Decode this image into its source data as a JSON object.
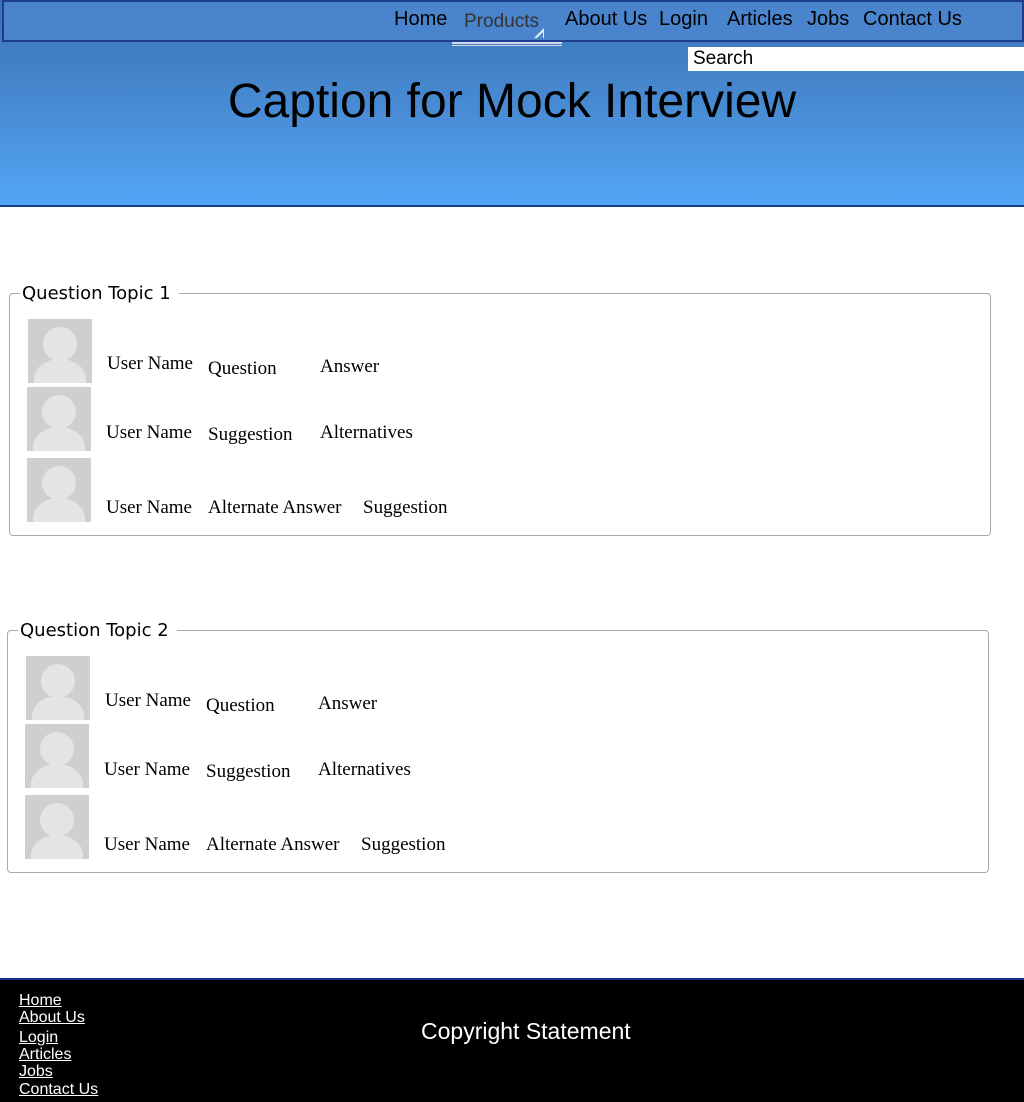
{
  "nav": {
    "home": "Home",
    "products": "Products",
    "about_us": "About Us",
    "login": "Login",
    "articles": "Articles",
    "jobs": "Jobs",
    "contact_us": "Contact Us"
  },
  "search": {
    "placeholder": "Search"
  },
  "header": {
    "title": "Caption for Mock Interview"
  },
  "topics": [
    {
      "title": "Question Topic 1",
      "rows": [
        {
          "user": "User Name",
          "col1": "Question",
          "col2": "Answer"
        },
        {
          "user": "User Name",
          "col1": "Suggestion",
          "col2": "Alternatives"
        },
        {
          "user": "User Name",
          "col1": "Alternate Answer",
          "col2": "Suggestion"
        }
      ]
    },
    {
      "title": "Question Topic 2",
      "rows": [
        {
          "user": "User Name",
          "col1": "Question",
          "col2": "Answer"
        },
        {
          "user": "User Name",
          "col1": "Suggestion",
          "col2": "Alternatives"
        },
        {
          "user": "User Name",
          "col1": "Alternate Answer",
          "col2": "Suggestion"
        }
      ]
    }
  ],
  "footer": {
    "links": [
      "Home",
      "About Us",
      "Login",
      "Articles",
      "Jobs",
      "Contact Us"
    ],
    "copyright": "Copyright Statement"
  },
  "icons": {
    "avatar": "user-avatar-icon",
    "dropdown": "dropdown-triangle-icon"
  },
  "colors": {
    "header_top": "#3a72b4",
    "header_bottom": "#52a6f6",
    "nav_border": "#1d3e8c",
    "footer_bg": "#000000"
  }
}
